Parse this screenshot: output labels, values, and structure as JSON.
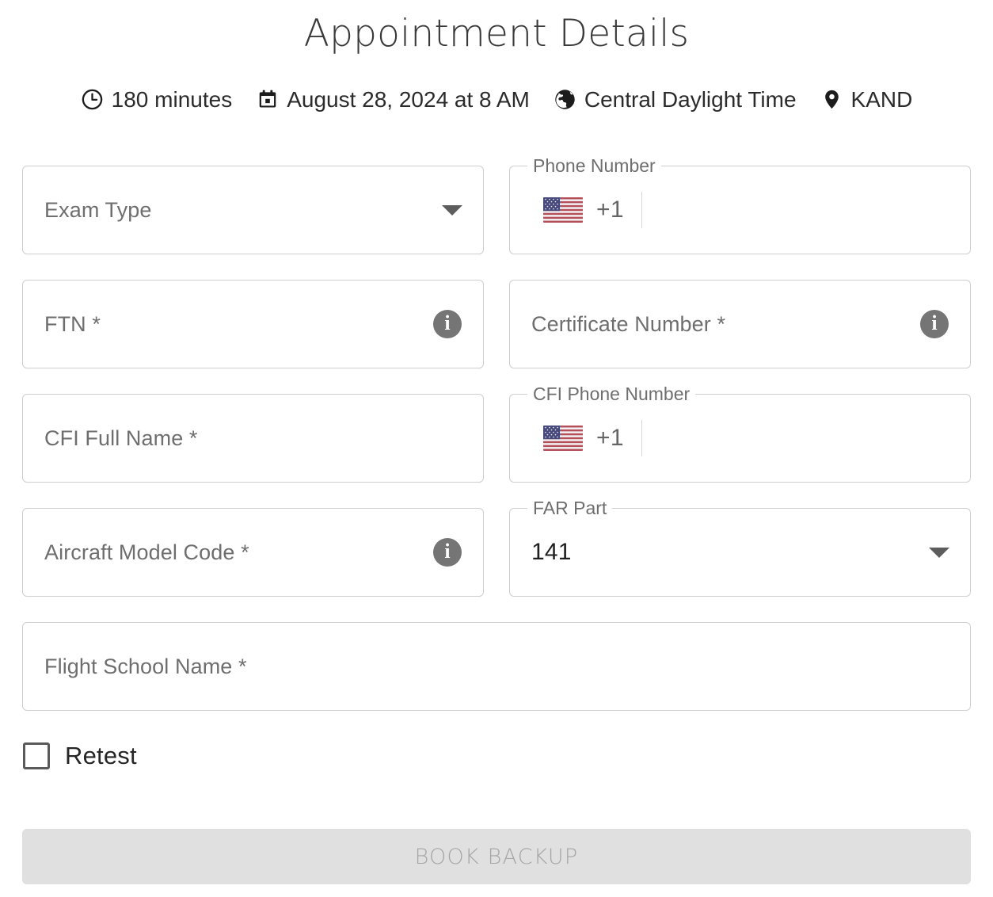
{
  "header": {
    "title": "Appointment Details",
    "meta": [
      {
        "icon": "clock-icon",
        "label": "180 minutes"
      },
      {
        "icon": "calendar-icon",
        "label": "August 28, 2024 at 8 AM"
      },
      {
        "icon": "globe-icon",
        "label": "Central Daylight Time"
      },
      {
        "icon": "location-pin-icon",
        "label": "KAND"
      }
    ]
  },
  "form": {
    "exam_type": {
      "placeholder": "Exam Type",
      "value": ""
    },
    "phone_number": {
      "legend": "Phone Number",
      "dial_code": "+1",
      "flag": "us-flag-icon",
      "value": ""
    },
    "ftn": {
      "placeholder": "FTN *",
      "value": ""
    },
    "certificate_number": {
      "placeholder": "Certificate Number *",
      "value": ""
    },
    "cfi_full_name": {
      "placeholder": "CFI Full Name *",
      "value": ""
    },
    "cfi_phone_number": {
      "legend": "CFI Phone Number",
      "dial_code": "+1",
      "flag": "us-flag-icon",
      "value": ""
    },
    "aircraft_model_code": {
      "placeholder": "Aircraft Model Code *",
      "value": ""
    },
    "far_part": {
      "legend": "FAR Part",
      "value": "141"
    },
    "flight_school_name": {
      "placeholder": "Flight School Name *",
      "value": ""
    },
    "retest": {
      "label": "Retest",
      "checked": false
    }
  },
  "actions": {
    "submit_label": "BOOK BACKUP"
  },
  "colors": {
    "field_border": "#cfcfcf",
    "placeholder_text": "#6e6e6e",
    "value_text": "#1f1f1f",
    "info_icon_bg": "#757575",
    "submit_bg": "#e0e0e0",
    "submit_text": "#a6a6a6",
    "flag_red": "#b5505a",
    "flag_navy": "#46497a"
  }
}
